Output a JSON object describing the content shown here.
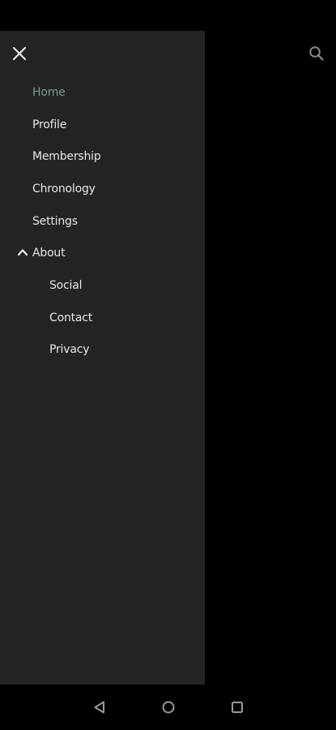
{
  "drawer": {
    "close_icon": "close-icon",
    "items": [
      {
        "label": "Home",
        "active": true
      },
      {
        "label": "Profile"
      },
      {
        "label": "Membership"
      },
      {
        "label": "Chronology"
      },
      {
        "label": "Settings"
      },
      {
        "label": "About",
        "expanded": true,
        "icon": "chevron-up-icon"
      },
      {
        "label": "Social",
        "sub": true
      },
      {
        "label": "Contact",
        "sub": true
      },
      {
        "label": "Privacy",
        "sub": true
      }
    ]
  },
  "header": {
    "search_icon": "search-icon"
  },
  "navbar": {
    "back_icon": "back-icon",
    "home_icon": "home-icon",
    "recents_icon": "recents-icon"
  },
  "colors": {
    "drawer_bg": "#242424",
    "active_item": "#7d9a8f",
    "text": "#e6e6e6",
    "background": "#000000"
  }
}
